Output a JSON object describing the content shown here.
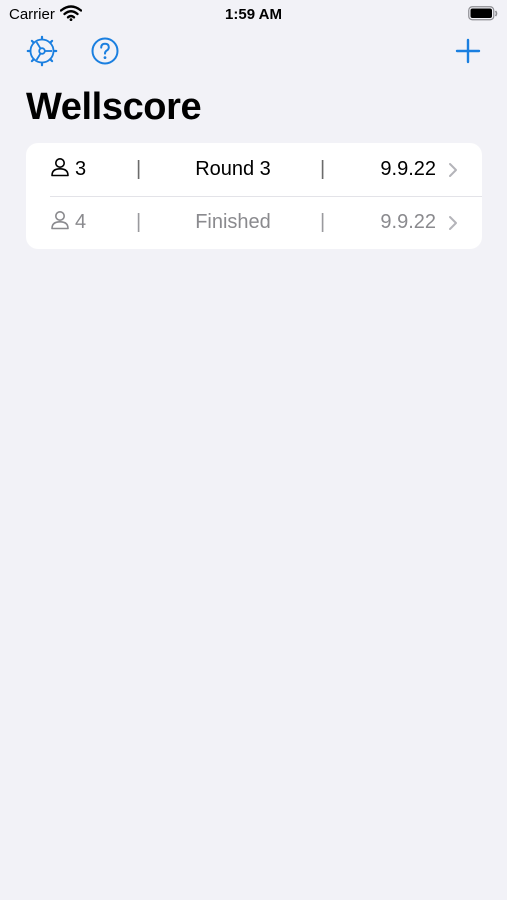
{
  "status_bar": {
    "carrier": "Carrier",
    "time": "1:59 AM",
    "wifi_icon": "wifi-icon",
    "battery_icon": "battery-icon"
  },
  "toolbar": {
    "settings_icon": "settings-gear-icon",
    "help_icon": "help-circle-icon",
    "add_icon": "plus-icon",
    "accent_color": "#1a7fe0"
  },
  "title": "Wellscore",
  "games": [
    {
      "players": "3",
      "separator": "|",
      "status": "Round 3",
      "date": "9.9.22",
      "finished": false
    },
    {
      "players": "4",
      "separator": "|",
      "status": "Finished",
      "date": "9.9.22",
      "finished": true
    }
  ]
}
